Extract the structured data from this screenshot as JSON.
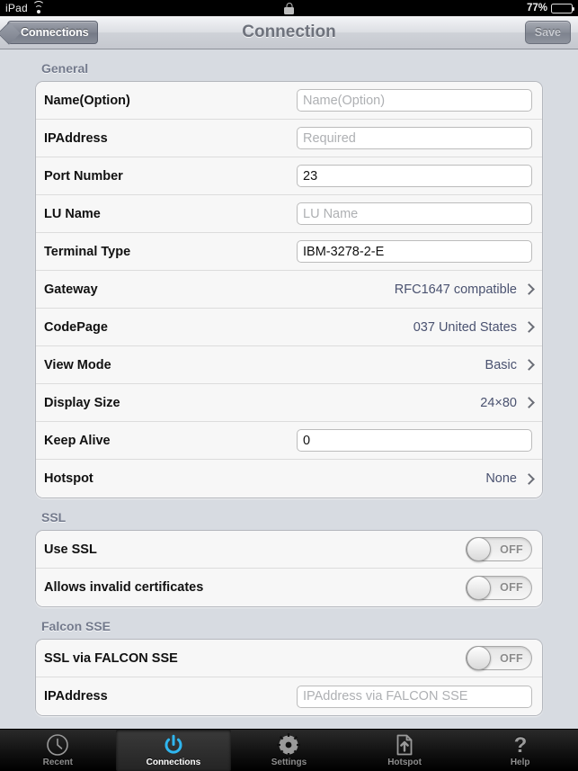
{
  "statusbar": {
    "device_name": "iPad",
    "wifi_icon": "wifi-icon",
    "lock_icon": "rotation-lock-icon",
    "battery_percent": "77%",
    "battery_level": 77
  },
  "navbar": {
    "back_label": "Connections",
    "title": "Connection",
    "save_label": "Save"
  },
  "sections": [
    {
      "header": "General",
      "rows": [
        {
          "label": "Name(Option)",
          "type": "input",
          "value": "",
          "placeholder": "Name(Option)"
        },
        {
          "label": "IPAddress",
          "type": "input",
          "value": "",
          "placeholder": "Required"
        },
        {
          "label": "Port Number",
          "type": "input",
          "value": "23",
          "placeholder": ""
        },
        {
          "label": "LU Name",
          "type": "input",
          "value": "",
          "placeholder": "LU Name"
        },
        {
          "label": "Terminal Type",
          "type": "input",
          "value": "IBM-3278-2-E",
          "placeholder": ""
        },
        {
          "label": "Gateway",
          "type": "disclosure",
          "value": "RFC1647 compatible"
        },
        {
          "label": "CodePage",
          "type": "disclosure",
          "value": "037 United States"
        },
        {
          "label": "View Mode",
          "type": "disclosure",
          "value": "Basic"
        },
        {
          "label": "Display Size",
          "type": "disclosure",
          "value": "24×80"
        },
        {
          "label": "Keep Alive",
          "type": "input",
          "value": "0",
          "placeholder": ""
        },
        {
          "label": "Hotspot",
          "type": "disclosure",
          "value": "None"
        }
      ]
    },
    {
      "header": "SSL",
      "rows": [
        {
          "label": "Use SSL",
          "type": "toggle",
          "value": "OFF"
        },
        {
          "label": "Allows invalid certificates",
          "type": "toggle",
          "value": "OFF"
        }
      ]
    },
    {
      "header": "Falcon SSE",
      "rows": [
        {
          "label": "SSL via FALCON SSE",
          "type": "toggle",
          "value": "OFF"
        },
        {
          "label": "IPAddress",
          "type": "input",
          "value": "",
          "placeholder": "IPAddress via FALCON SSE"
        }
      ]
    }
  ],
  "tabbar": {
    "items": [
      {
        "label": "Recent",
        "icon": "clock-icon",
        "active": false
      },
      {
        "label": "Connections",
        "icon": "power-icon",
        "active": true
      },
      {
        "label": "Settings",
        "icon": "gear-icon",
        "active": false
      },
      {
        "label": "Hotspot",
        "icon": "document-upload-icon",
        "active": false
      },
      {
        "label": "Help",
        "icon": "question-mark-icon",
        "active": false
      }
    ]
  },
  "colors": {
    "accent": "#2fb6ef",
    "section_header": "#737a8c",
    "disclosure_value": "#4a5270",
    "page_background": "#d7dbe1"
  }
}
